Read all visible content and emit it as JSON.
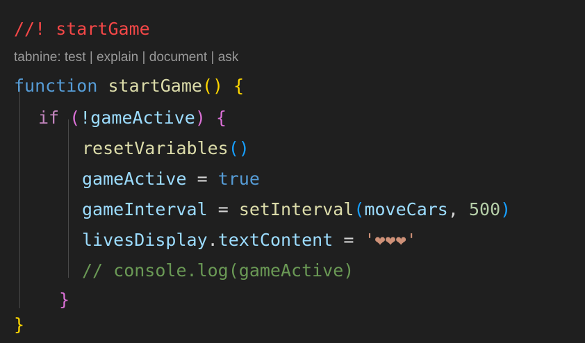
{
  "code": {
    "comment_title": "//! startGame",
    "lens": {
      "prefix": "tabnine:",
      "actions": [
        "test",
        "explain",
        "document",
        "ask"
      ],
      "separator": "|"
    },
    "tokens": {
      "function_kw": "function",
      "function_name": "startGame",
      "paren_open": "(",
      "paren_close": ")",
      "brace_open": "{",
      "brace_close": "}",
      "if_kw": "if",
      "not_game_active": "!gameActive",
      "reset_call": "resetVariables",
      "game_active": "gameActive",
      "assign": "=",
      "true_kw": "true",
      "game_interval": "gameInterval",
      "set_interval": "setInterval",
      "move_cars": "moveCars",
      "comma": ",",
      "interval_ms": "500",
      "lives_display": "livesDisplay",
      "dot": ".",
      "text_content": "textContent",
      "lives_string": "'❤❤❤'",
      "commented_line": "// console.log(gameActive)"
    }
  },
  "colors": {
    "background": "#1f1f1f",
    "keyword": "#569cd6",
    "function": "#dcdcaa",
    "variable": "#9cdcfe",
    "string": "#ce9178",
    "number": "#b5cea8",
    "comment": "#6a9955",
    "highlight_comment": "#f44747"
  }
}
